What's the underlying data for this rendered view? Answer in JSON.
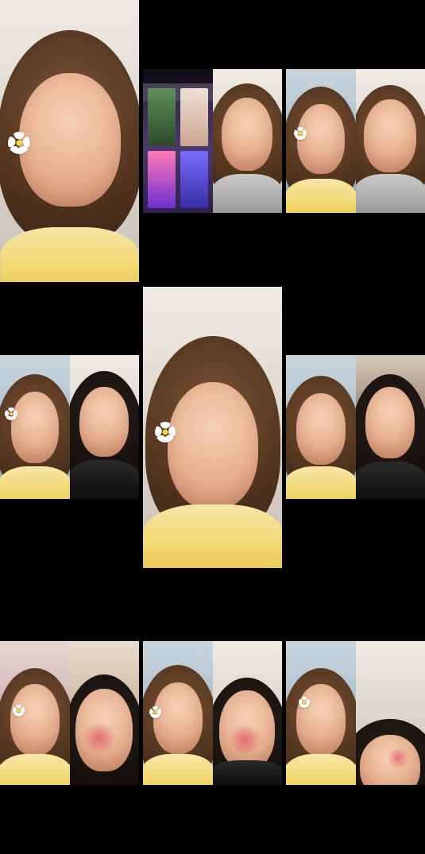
{
  "grid": {
    "frames": [
      {
        "id": "top-left",
        "layout": "single",
        "subject": "person-with-flower"
      },
      {
        "id": "top-middle",
        "layout": "split",
        "left": "phone-screen",
        "right": "person"
      },
      {
        "id": "top-right",
        "layout": "split",
        "left": "person-with-flower",
        "right": "person"
      },
      {
        "id": "middle-left",
        "layout": "split",
        "left": "person-with-flower",
        "right": "person"
      },
      {
        "id": "middle-center",
        "layout": "single",
        "subject": "person-with-flower"
      },
      {
        "id": "middle-right",
        "layout": "split",
        "left": "person",
        "right": "person"
      },
      {
        "id": "bottom-left",
        "layout": "split",
        "left": "person-with-flower",
        "right": "person-with-red-cheeks"
      },
      {
        "id": "bottom-middle",
        "layout": "split",
        "left": "person-with-flower",
        "right": "person-with-red-cheeks"
      },
      {
        "id": "bottom-right",
        "layout": "split",
        "left": "person-with-flower",
        "right": "person-with-red-cheeks"
      }
    ]
  }
}
